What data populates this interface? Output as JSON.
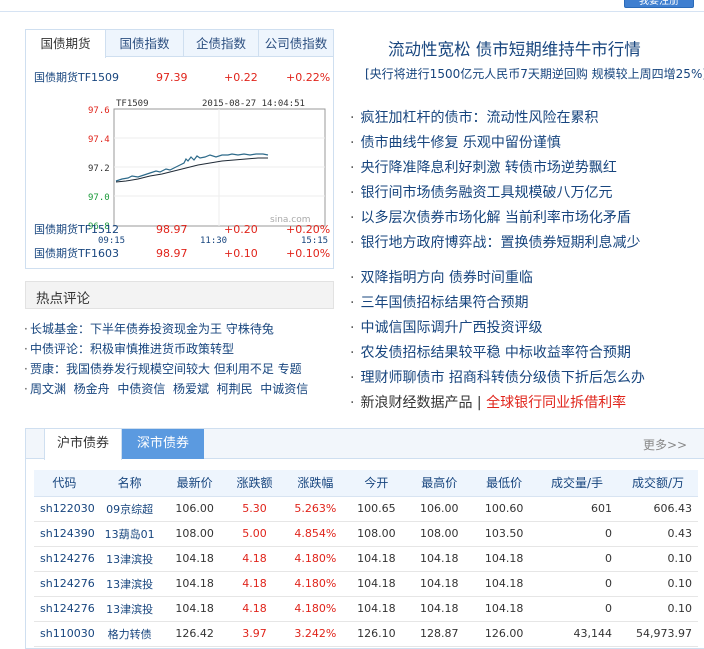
{
  "top_button": "我要注册",
  "left": {
    "tabs": [
      "国债期货",
      "国债指数",
      "企债指数",
      "公司债指数"
    ],
    "main_quote": {
      "name": "国债期货TF1509",
      "price": "97.39",
      "change": "+0.22",
      "pct": "+0.22%"
    },
    "chart": {
      "code": "TF1509",
      "datetime": "2015-08-27 14:04:51",
      "watermark": "sina.com",
      "y_ticks": [
        "97.6",
        "97.4",
        "97.2",
        "97.0",
        "96.8"
      ],
      "x_ticks": [
        "09:15",
        "11:30",
        "15:15"
      ]
    },
    "quotes": [
      {
        "name": "国债期货TF1512",
        "price": "98.97",
        "change": "+0.20",
        "pct": "+0.20%"
      },
      {
        "name": "国债期货TF1603",
        "price": "98.97",
        "change": "+0.10",
        "pct": "+0.10%"
      }
    ],
    "hot_title": "热点评论",
    "hot_items": [
      [
        "长城基金：下半年债券投资现金为王 守株待兔"
      ],
      [
        "中债评论：积极审慎推进货币政策转型"
      ],
      [
        "贾康：我国债券发行规模空间较大 但利用不足 专题"
      ],
      [
        "周文渊",
        "杨金舟",
        "中债资信",
        "杨爱斌",
        "柯荆民",
        "中诚资信"
      ]
    ]
  },
  "right": {
    "headline": "流动性宽松 债市短期维持牛市行情",
    "subline": "[央行将进行1500亿元人民币7天期逆回购 规模较上周四增25%]",
    "news_group1": [
      "疯狂加杠杆的债市：流动性风险在累积",
      "债市曲线牛修复 乐观中留份谨慎",
      "央行降准降息利好刺激 转债市场逆势飘红",
      "银行间市场债务融资工具规模破八万亿元",
      "以多层次债券市场化解 当前利率市场化矛盾",
      "银行地方政府博弈战：置换债券短期利息减少"
    ],
    "news_group2": [
      "双降指明方向 债券时间重临",
      "三年国债招标结果符合预期",
      "中诚信国际调升广西投资评级",
      "农发债招标结果较平稳 中标收益率符合预期",
      "理财师聊债市 招商科转债分级债下折后怎么办"
    ],
    "last_news": {
      "plain": "新浪财经数据产品",
      "sep": "|",
      "red": "全球银行同业拆借利率"
    }
  },
  "table": {
    "tabs": [
      "沪市债券",
      "深市债券"
    ],
    "more": "更多>>",
    "headers": [
      "代码",
      "名称",
      "最新价",
      "涨跌额",
      "涨跌幅",
      "今开",
      "最高价",
      "最低价",
      "成交量/手",
      "成交额/万"
    ],
    "rows": [
      [
        "sh122030",
        "09京综超",
        "106.00",
        "5.30",
        "5.263%",
        "100.65",
        "106.00",
        "100.60",
        "601",
        "606.43"
      ],
      [
        "sh124390",
        "13葫岛01",
        "108.00",
        "5.00",
        "4.854%",
        "108.00",
        "108.00",
        "103.50",
        "0",
        "0.43"
      ],
      [
        "sh124276",
        "13津滨投",
        "104.18",
        "4.18",
        "4.180%",
        "104.18",
        "104.18",
        "104.18",
        "0",
        "0.10"
      ],
      [
        "sh124276",
        "13津滨投",
        "104.18",
        "4.18",
        "4.180%",
        "104.18",
        "104.18",
        "104.18",
        "0",
        "0.10"
      ],
      [
        "sh124276",
        "13津滨投",
        "104.18",
        "4.18",
        "4.180%",
        "104.18",
        "104.18",
        "104.18",
        "0",
        "0.10"
      ],
      [
        "sh110030",
        "格力转债",
        "126.42",
        "3.97",
        "3.242%",
        "126.10",
        "128.87",
        "126.00",
        "43,144",
        "54,973.97"
      ]
    ]
  }
}
